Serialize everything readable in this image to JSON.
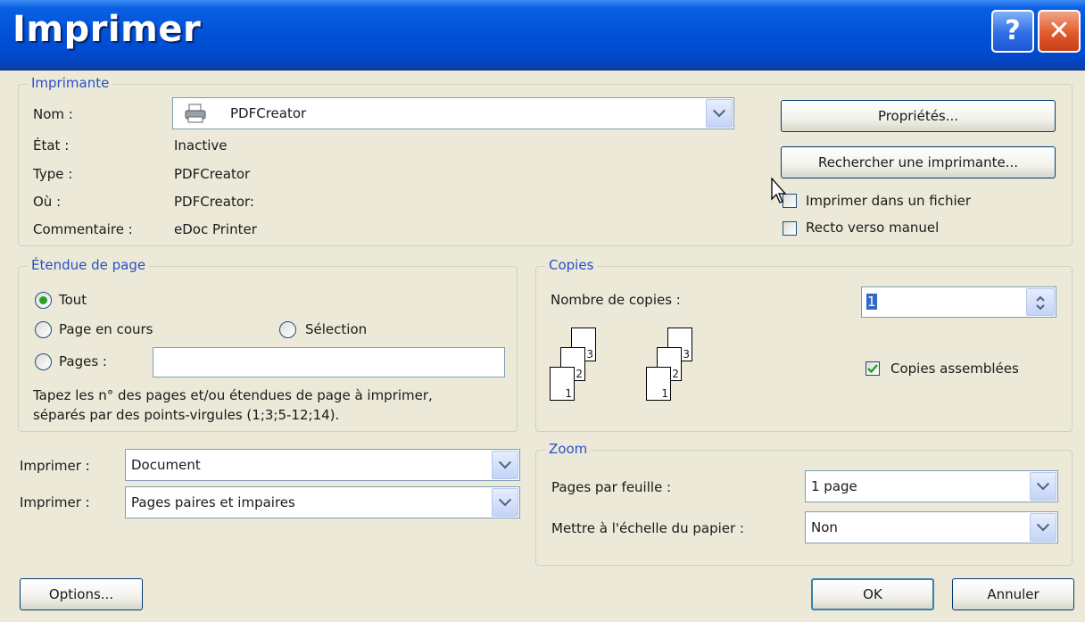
{
  "window": {
    "title": "Imprimer",
    "help_label": "?",
    "close_label": "✕"
  },
  "printer": {
    "legend": "Imprimante",
    "name_label": "Nom :",
    "name_value": "PDFCreator",
    "state_label": "État :",
    "state_value": "Inactive",
    "type_label": "Type :",
    "type_value": "PDFCreator",
    "where_label": "Où :",
    "where_value": "PDFCreator:",
    "comment_label": "Commentaire :",
    "comment_value": "eDoc Printer",
    "properties_button": "Propriétés...",
    "find_printer_button": "Rechercher une imprimante...",
    "print_to_file_label": "Imprimer dans un fichier",
    "print_to_file_checked": false,
    "manual_duplex_label": "Recto verso manuel",
    "manual_duplex_checked": false
  },
  "page_range": {
    "legend": "Étendue de page",
    "all_label": "Tout",
    "current_page_label": "Page en cours",
    "selection_label": "Sélection",
    "pages_label": "Pages :",
    "pages_value": "",
    "hint_line1": "Tapez les n° des pages et/ou étendues de page à imprimer,",
    "hint_line2": "séparés par des points-virgules (1;3;5-12;14).",
    "selected": "all"
  },
  "copies": {
    "legend": "Copies",
    "count_label": "Nombre de copies :",
    "count_value": "1",
    "collate_label": "Copies assemblées",
    "collate_checked": true,
    "page_numbers": [
      "1",
      "2",
      "3"
    ]
  },
  "print_what": {
    "label1": "Imprimer :",
    "value1": "Document",
    "label2": "Imprimer :",
    "value2": "Pages paires et impaires"
  },
  "zoom": {
    "legend": "Zoom",
    "pages_per_sheet_label": "Pages par feuille :",
    "pages_per_sheet_value": "1 page",
    "scale_label": "Mettre à l'échelle du papier :",
    "scale_value": "Non"
  },
  "footer": {
    "options_button": "Options...",
    "ok_button": "OK",
    "cancel_button": "Annuler"
  },
  "colors": {
    "titlebar": "#0053D8",
    "legend_text": "#2850C8",
    "dialog_bg": "#ECE9D8",
    "radio_dot": "#2AA12A",
    "checkmark": "#21A121"
  }
}
